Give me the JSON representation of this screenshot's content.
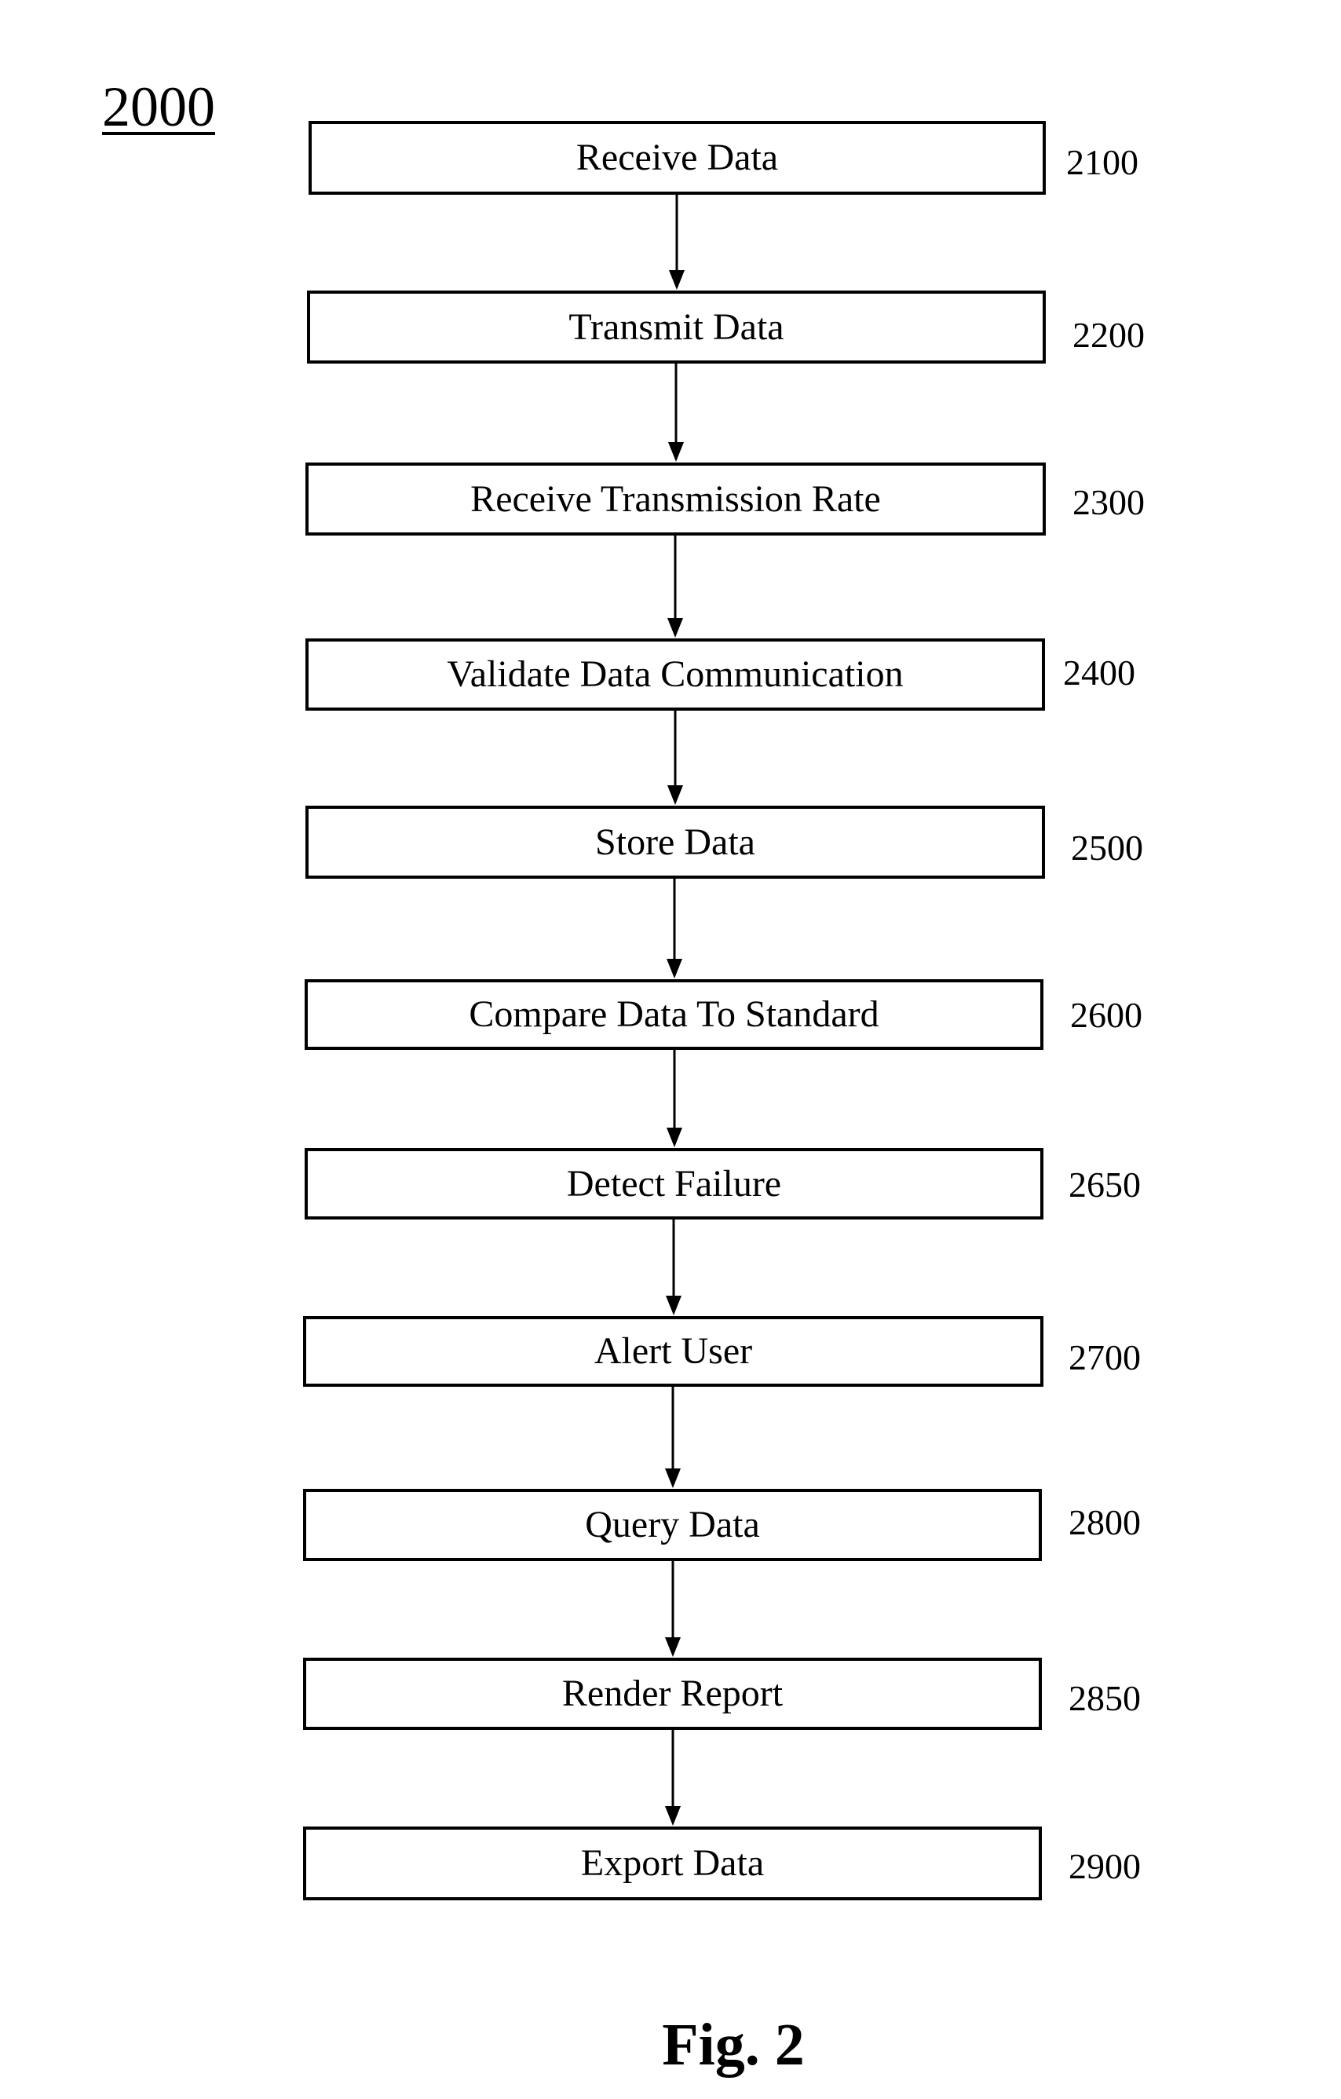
{
  "figure": {
    "id_label": "2000",
    "caption": "Fig. 2"
  },
  "steps": [
    {
      "label": "Receive Data",
      "ref": "2100"
    },
    {
      "label": "Transmit Data",
      "ref": "2200"
    },
    {
      "label": "Receive Transmission Rate",
      "ref": "2300"
    },
    {
      "label": "Validate Data Communication",
      "ref": "2400"
    },
    {
      "label": "Store Data",
      "ref": "2500"
    },
    {
      "label": "Compare Data To Standard",
      "ref": "2600"
    },
    {
      "label": "Detect Failure",
      "ref": "2650"
    },
    {
      "label": "Alert User",
      "ref": "2700"
    },
    {
      "label": "Query Data",
      "ref": "2800"
    },
    {
      "label": "Render Report",
      "ref": "2850"
    },
    {
      "label": "Export Data",
      "ref": "2900"
    }
  ],
  "connections": [
    {
      "from": "2100",
      "to": "2200"
    },
    {
      "from": "2200",
      "to": "2300"
    },
    {
      "from": "2300",
      "to": "2400"
    },
    {
      "from": "2400",
      "to": "2500"
    },
    {
      "from": "2500",
      "to": "2600"
    },
    {
      "from": "2600",
      "to": "2650"
    },
    {
      "from": "2650",
      "to": "2700"
    },
    {
      "from": "2700",
      "to": "2800"
    },
    {
      "from": "2800",
      "to": "2850"
    },
    {
      "from": "2850",
      "to": "2900"
    }
  ]
}
